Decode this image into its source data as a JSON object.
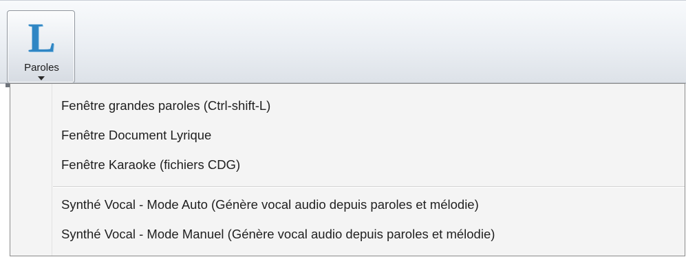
{
  "toolbar": {
    "button": {
      "icon_letter": "L",
      "label": "Paroles",
      "icon": "lyrics-L-icon",
      "icon_color": "#2f86c4"
    }
  },
  "menu": {
    "items": [
      {
        "label": "Fenêtre grandes paroles (Ctrl-shift-L)"
      },
      {
        "label": "Fenêtre Document Lyrique"
      },
      {
        "label": "Fenêtre Karaoke (fichiers CDG)"
      },
      {
        "label": "Synthé Vocal - Mode Auto (Génère vocal audio depuis paroles et mélodie)"
      },
      {
        "label": "Synthé Vocal - Mode Manuel (Génère vocal audio depuis paroles et mélodie)"
      }
    ]
  }
}
